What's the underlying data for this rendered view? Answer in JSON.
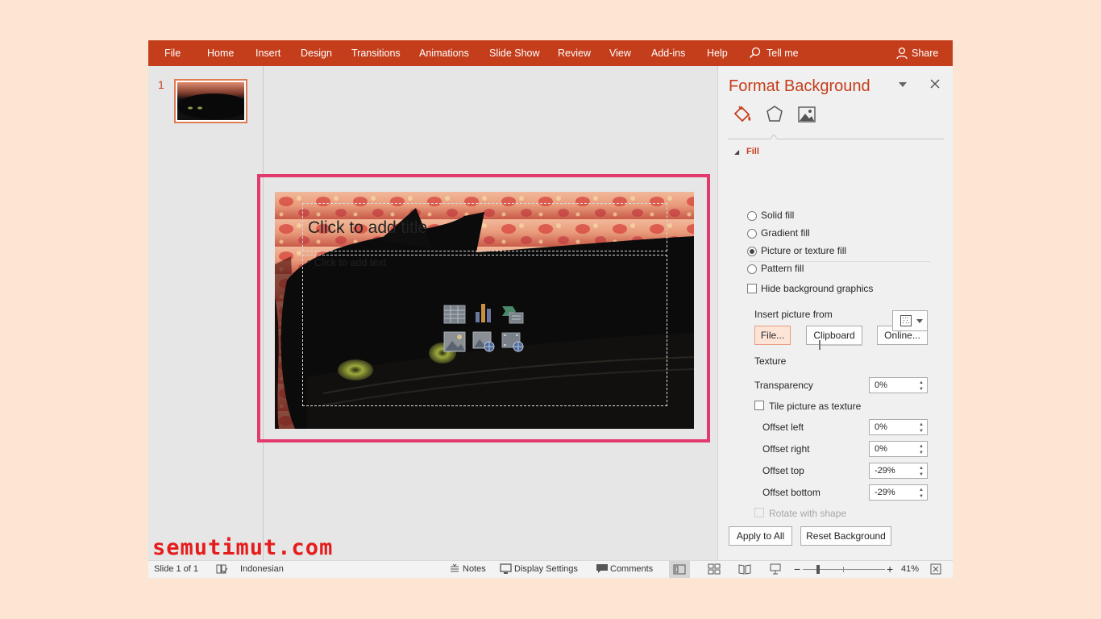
{
  "ribbon": {
    "tabs": [
      "File",
      "Home",
      "Insert",
      "Design",
      "Transitions",
      "Animations",
      "Slide Show",
      "Review",
      "View",
      "Add-ins",
      "Help"
    ],
    "tell_me": "Tell me",
    "share": "Share"
  },
  "thumbnails": {
    "slide_number": "1"
  },
  "slide": {
    "title_placeholder": "Click to add title",
    "body_placeholder": "Click to add text",
    "content_icons": [
      "table-icon",
      "chart-icon",
      "smartart-icon",
      "picture-icon",
      "online-picture-icon",
      "video-icon"
    ]
  },
  "format_pane": {
    "title": "Format Background",
    "tab_icons": [
      "fill-bucket-icon",
      "pentagon-icon",
      "picture-icon"
    ],
    "section": "Fill",
    "fill_options": [
      {
        "label": "Solid fill",
        "selected": false
      },
      {
        "label": "Gradient fill",
        "selected": false
      },
      {
        "label": "Picture or texture fill",
        "selected": true
      },
      {
        "label": "Pattern fill",
        "selected": false
      }
    ],
    "hide_background_graphics": "Hide background graphics",
    "insert_picture_from": "Insert picture from",
    "buttons": {
      "file": "File...",
      "clipboard": "Clipboard",
      "online": "Online..."
    },
    "texture_label": "Texture",
    "transparency": {
      "label": "Transparency",
      "value": "0%",
      "level": 0.0
    },
    "tile_label": "Tile picture as texture",
    "offsets": [
      {
        "label": "Offset left",
        "value": "0%"
      },
      {
        "label": "Offset right",
        "value": "0%"
      },
      {
        "label": "Offset top",
        "value": "-29%"
      },
      {
        "label": "Offset bottom",
        "value": "-29%"
      }
    ],
    "rotate_label": "Rotate with shape",
    "apply_all": "Apply to All",
    "reset": "Reset Background"
  },
  "status_bar": {
    "slide_info": "Slide 1 of 1",
    "language": "Indonesian",
    "notes": "Notes",
    "display_settings": "Display Settings",
    "comments": "Comments",
    "zoom": "41%",
    "zoom_level": 0.41
  },
  "watermark": "semutimut.com",
  "colors": {
    "accent": "#c43e1c",
    "highlight": "#e33a6e",
    "watermark": "#e61c1c"
  }
}
